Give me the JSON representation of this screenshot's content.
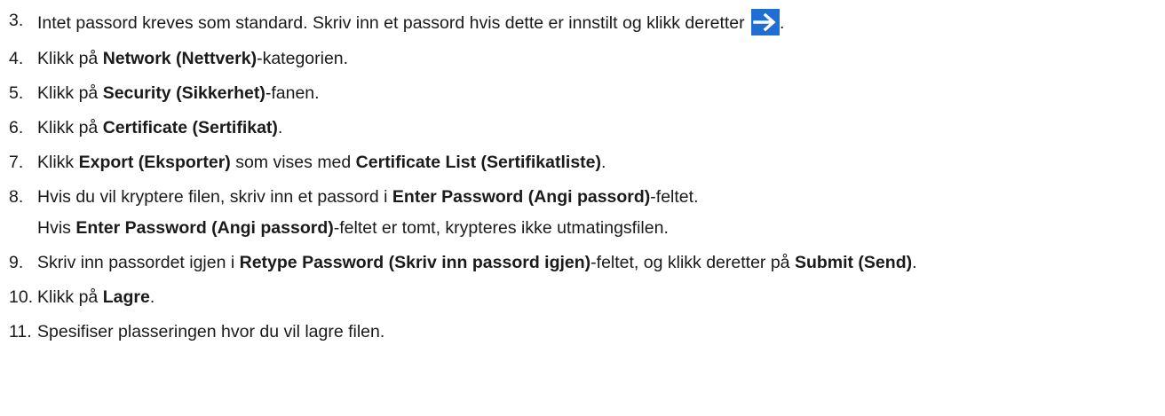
{
  "steps": [
    {
      "num": "3.",
      "text1": "Intet passord kreves som standard. Skriv inn et passord hvis dette er innstilt og klikk deretter",
      "text2": "."
    },
    {
      "num": "4.",
      "pre": "Klikk på ",
      "b1": "Network (Nettverk)",
      "post": "-kategorien."
    },
    {
      "num": "5.",
      "pre": "Klikk på ",
      "b1": "Security (Sikkerhet)",
      "post": "-fanen."
    },
    {
      "num": "6.",
      "pre": "Klikk på ",
      "b1": "Certificate (Sertifikat)",
      "post": "."
    },
    {
      "num": "7.",
      "pre": "Klikk ",
      "b1": "Export (Eksporter)",
      "mid": " som vises med ",
      "b2": "Certificate List (Sertifikatliste)",
      "post": "."
    },
    {
      "num": "8.",
      "pre": "Hvis du vil kryptere filen, skriv inn et passord i ",
      "b1": "Enter Password (Angi passord)",
      "post": "-feltet.",
      "sub_pre": "Hvis ",
      "sub_b": "Enter Password (Angi passord)",
      "sub_post": "-feltet er tomt, krypteres ikke utmatingsfilen."
    },
    {
      "num": "9.",
      "pre": "Skriv inn passordet igjen i ",
      "b1": "Retype Password (Skriv inn passord igjen)",
      "mid": "-feltet, og klikk deretter på ",
      "b2": "Submit (Send)",
      "post": "."
    },
    {
      "num": "10.",
      "pre": "Klikk på ",
      "b1": "Lagre",
      "post": "."
    },
    {
      "num": "11.",
      "text1": "Spesifiser plasseringen hvor du vil lagre filen."
    }
  ],
  "icons": {
    "arrow": "right-arrow-icon",
    "arrow_bg": "#1e6fd1",
    "arrow_fg": "#ffffff"
  }
}
